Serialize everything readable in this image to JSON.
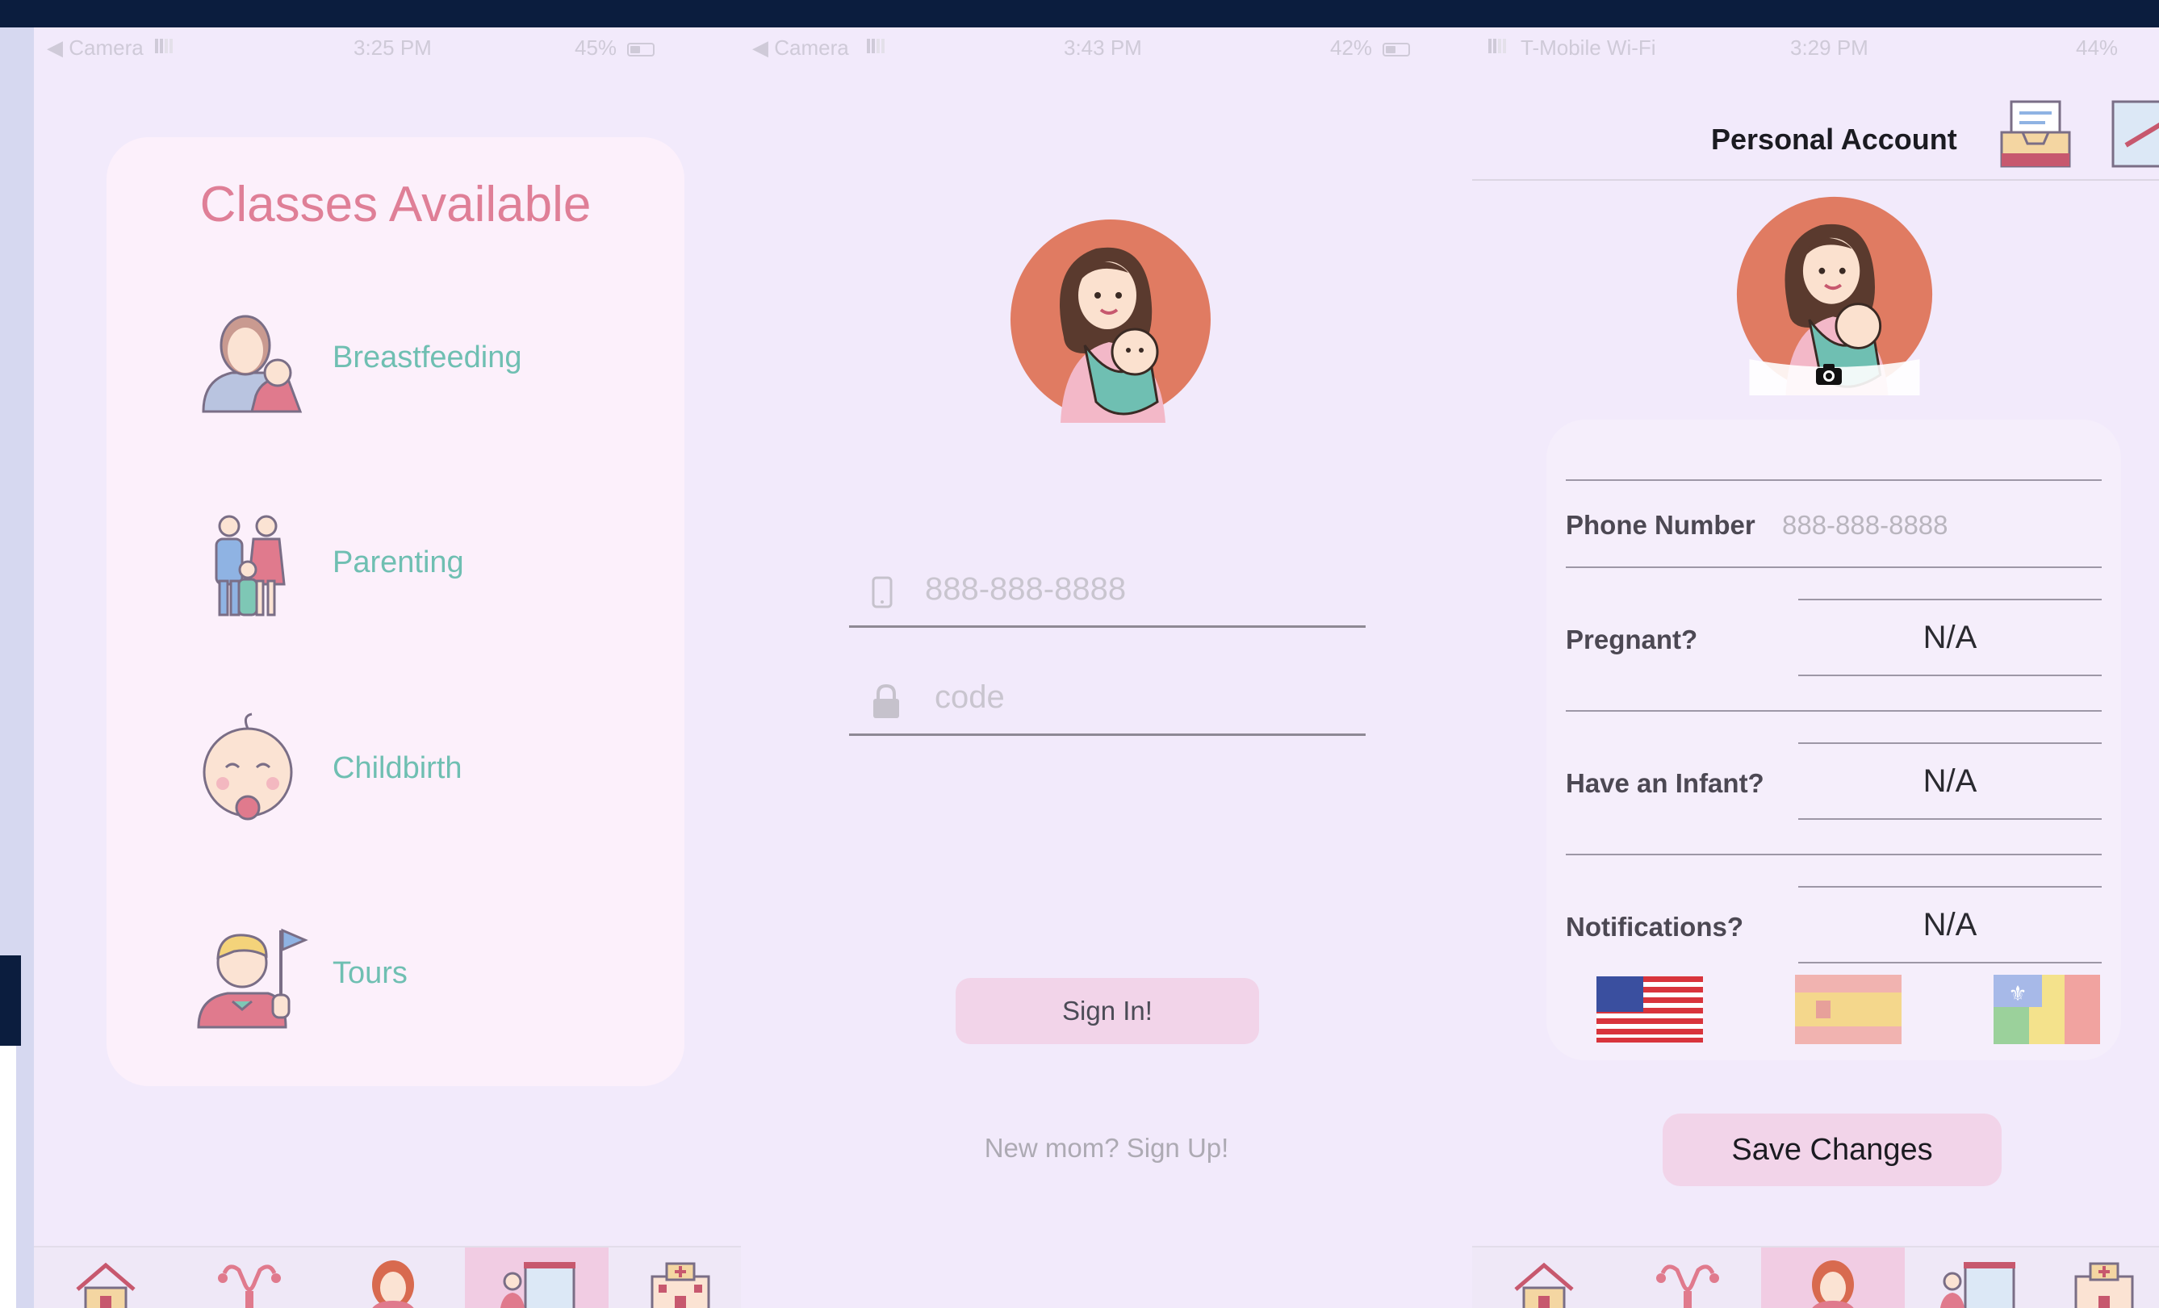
{
  "panels": {
    "classes": {
      "status": {
        "carrier": "◀ Camera",
        "time": "3:25 PM",
        "battery": "45%"
      },
      "title": "Classes Available",
      "items": [
        {
          "label": "Breastfeeding",
          "icon": "breastfeeding-icon"
        },
        {
          "label": "Parenting",
          "icon": "family-icon"
        },
        {
          "label": "Childbirth",
          "icon": "baby-face-icon"
        },
        {
          "label": "Tours",
          "icon": "tour-guide-icon"
        }
      ],
      "tabs": [
        "home-icon",
        "uterus-icon",
        "mother-icon",
        "classroom-icon",
        "hospital-icon"
      ],
      "selected_tab": "classroom-icon"
    },
    "login": {
      "status": {
        "carrier": "◀ Camera",
        "time": "3:43 PM",
        "battery": "42%"
      },
      "avatar": "mother-with-baby-avatar",
      "phone_placeholder": "888-888-8888",
      "code_placeholder": "code",
      "signin_label": "Sign In!",
      "signup_label": "New mom? Sign Up!"
    },
    "account": {
      "status": {
        "carrier": "T-Mobile Wi-Fi",
        "time": "3:29 PM",
        "battery": "44%"
      },
      "title": "Personal Account",
      "avatar": "mother-with-baby-avatar",
      "fields": [
        {
          "label": "Phone Number",
          "value": "888-888-8888"
        },
        {
          "label": "Pregnant?",
          "value": "N/A"
        },
        {
          "label": "Have an Infant?",
          "value": "N/A"
        },
        {
          "label": "Notifications?",
          "value": "N/A"
        }
      ],
      "flags": [
        "us-flag-icon",
        "spain-flag-icon",
        "haiti-french-flag-icon"
      ],
      "save_label": "Save Changes",
      "tabs": [
        "home-icon",
        "uterus-icon",
        "mother-icon",
        "classroom-icon",
        "hospital-icon"
      ],
      "selected_tab": "mother-icon"
    }
  },
  "colors": {
    "background": "#f2eafb",
    "card": "#fcf0fb",
    "title_pink": "#df7f97",
    "teal_label": "#6fbfb2",
    "button_pink": "#f2d4e9",
    "top_bar": "#0b1d3e"
  }
}
